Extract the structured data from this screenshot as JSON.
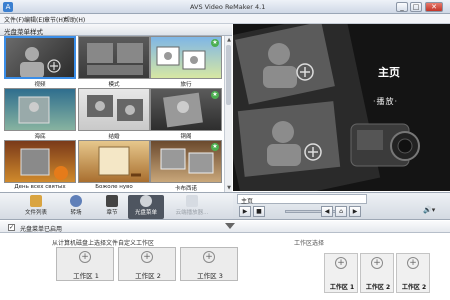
{
  "window": {
    "title": "AVS Video ReMaker 4.1",
    "controls": [
      "_",
      "□",
      "✕"
    ]
  },
  "menu": [
    "文件(F)",
    "编辑(E)",
    "章节(H)",
    "帮助(H)"
  ],
  "menu_panel": {
    "header": "光盘菜单样式",
    "tiles": [
      {
        "label": "视频",
        "selected": true
      },
      {
        "label": "模式"
      },
      {
        "label": "旅行"
      },
      {
        "label": "海底"
      },
      {
        "label": "结婚"
      },
      {
        "label": "铜阁"
      },
      {
        "label": "День всех святых"
      },
      {
        "label": "Божоле нуво"
      },
      {
        "label": "卡布西诺"
      }
    ]
  },
  "preview": {
    "title": "主页",
    "play": "·播放·"
  },
  "toolbar": {
    "buttons": [
      {
        "label": "文件列表"
      },
      {
        "label": "转场"
      },
      {
        "label": "章节"
      },
      {
        "label": "光盘菜单",
        "active": true
      },
      {
        "label": "云端播放器..."
      }
    ]
  },
  "player": {
    "chapter": "主页",
    "play": "▶",
    "stop": "■",
    "prev": "◀",
    "home": "⌂",
    "next": "▶"
  },
  "disc_menu": {
    "header": "光盘菜单已启用",
    "hint": "从计算机磁盘上选择文件自定义工作区",
    "work_areas": [
      "工作区 1",
      "工作区 2",
      "工作区 3"
    ],
    "side_hint": "工作区选择",
    "side_areas": [
      "工作区 1",
      "工作区 2",
      "工作区 2"
    ]
  },
  "colors": {
    "accent": "#3b8ee8",
    "preview_bg": "#141414",
    "active_tab": "#4e5560"
  }
}
